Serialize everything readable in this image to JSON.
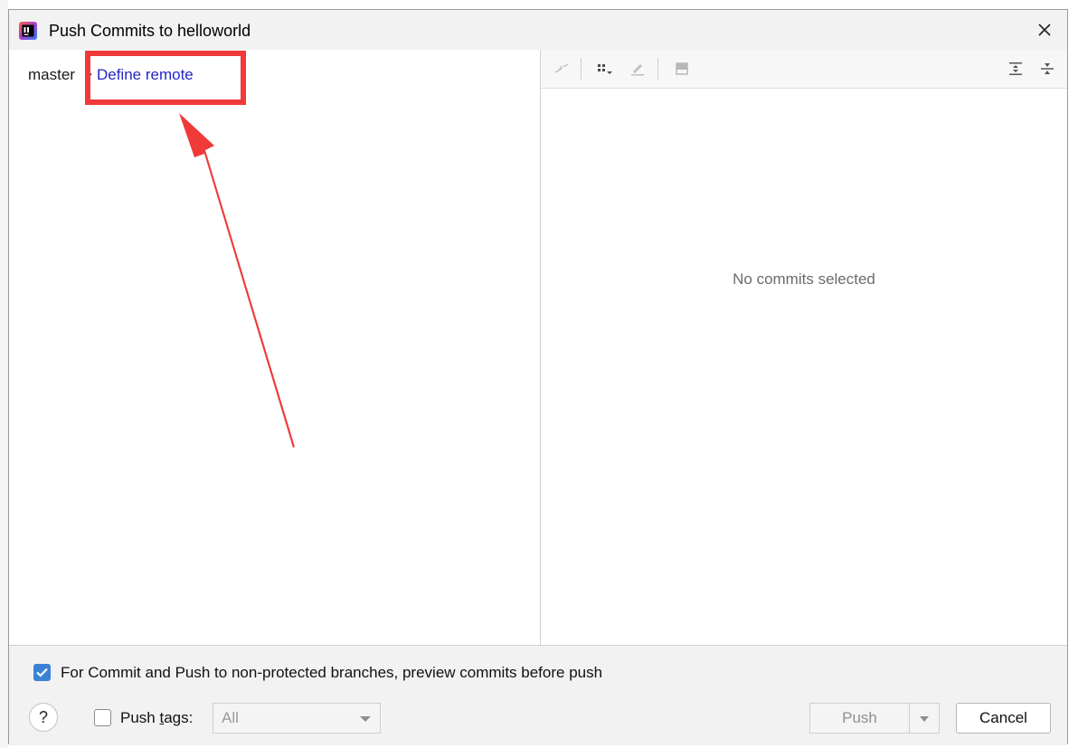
{
  "dialog": {
    "title": "Push Commits to helloworld",
    "close_glyph": "✕"
  },
  "left_pane": {
    "branch_local": "master",
    "branch_arrow": "→",
    "define_remote_label": "Define remote"
  },
  "right_pane": {
    "empty_message": "No commits selected"
  },
  "footer": {
    "preview_label": "For Commit and Push to non-protected branches, preview commits before push",
    "preview_checked": true,
    "help_glyph": "?",
    "push_tags_prefix": "Push ",
    "push_tags_mnemonic": "t",
    "push_tags_suffix": "ags:",
    "push_tags_checked": false,
    "tags_select_value": "All",
    "push_label": "Push",
    "cancel_label": "Cancel"
  },
  "colors": {
    "link": "#2525c8",
    "checkbox_accent": "#3a82d4",
    "annotation": "#f03a3a"
  }
}
